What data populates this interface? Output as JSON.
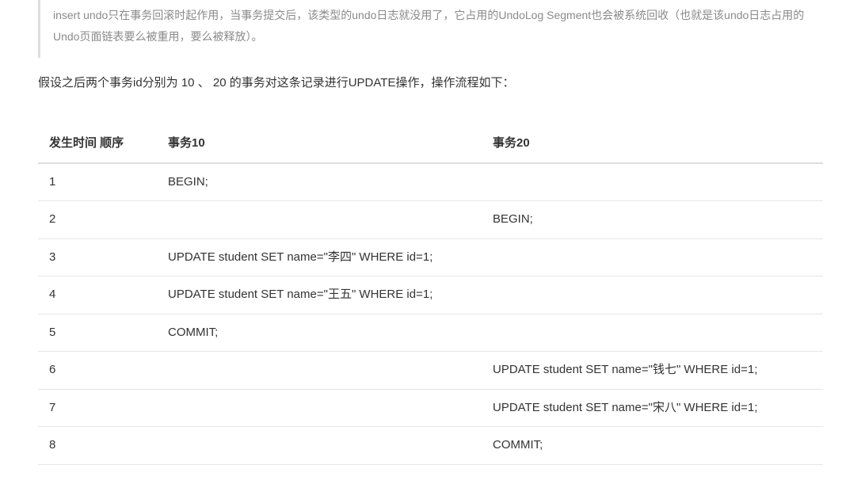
{
  "note": {
    "text": "insert undo只在事务回滚时起作用，当事务提交后，该类型的undo日志就没用了，它占用的UndoLog Segment也会被系统回收（也就是该undo日志占用的Undo页面链表要么被重用，要么被释放）。"
  },
  "paragraph": {
    "text": "假设之后两个事务id分别为 10 、 20 的事务对这条记录进行UPDATE操作，操作流程如下："
  },
  "table": {
    "headers": {
      "col1": "发生时间 顺序",
      "col2": "事务10",
      "col3": "事务20"
    },
    "rows": [
      {
        "seq": "1",
        "t10": "BEGIN;",
        "t20": ""
      },
      {
        "seq": "2",
        "t10": "",
        "t20": "BEGIN;"
      },
      {
        "seq": "3",
        "t10": "UPDATE student SET name=\"李四\" WHERE id=1;",
        "t20": ""
      },
      {
        "seq": "4",
        "t10": "UPDATE student SET name=\"王五\" WHERE id=1;",
        "t20": ""
      },
      {
        "seq": "5",
        "t10": "COMMIT;",
        "t20": ""
      },
      {
        "seq": "6",
        "t10": "",
        "t20": "UPDATE student SET name=\"钱七\" WHERE id=1;"
      },
      {
        "seq": "7",
        "t10": "",
        "t20": "UPDATE student SET name=\"宋八\" WHERE id=1;"
      },
      {
        "seq": "8",
        "t10": "",
        "t20": "COMMIT;"
      }
    ]
  }
}
